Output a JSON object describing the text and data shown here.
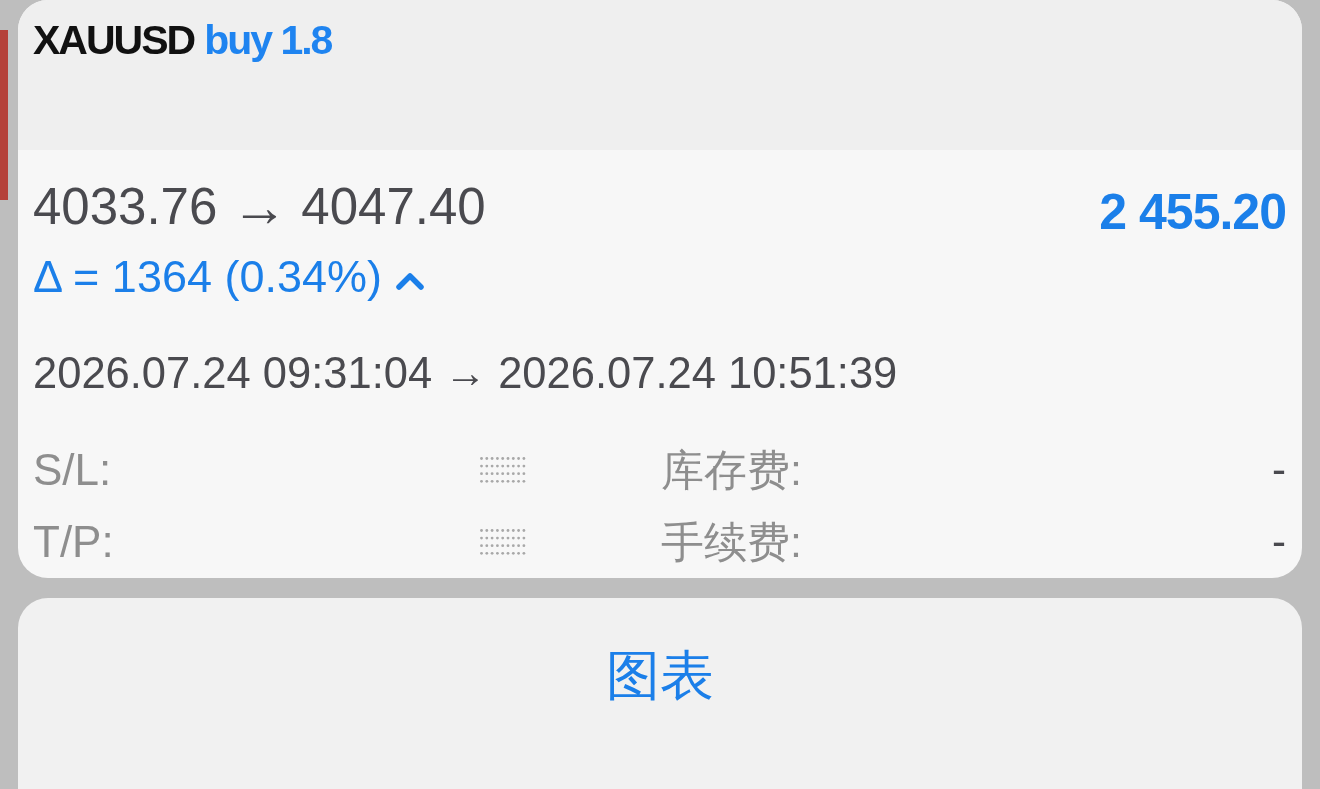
{
  "header": {
    "symbol": "XAUUSD",
    "order": "buy 1.8"
  },
  "trade": {
    "open_price": "4033.76",
    "arrow": "→",
    "close_price": "4047.40",
    "profit": "2 455.20",
    "delta": "Δ = 1364 (0.34%)",
    "rising": true,
    "open_time": "2026.07.24 09:31:04",
    "time_arrow": "→",
    "close_time": "2026.07.24 10:51:39"
  },
  "details": [
    {
      "label": "S/L:",
      "masked": true,
      "fee_label": "库存费:",
      "fee_value": "-"
    },
    {
      "label": "T/P:",
      "masked": true,
      "fee_label": "手续费:",
      "fee_value": "-"
    }
  ],
  "actions": [
    {
      "label": "图表"
    }
  ]
}
